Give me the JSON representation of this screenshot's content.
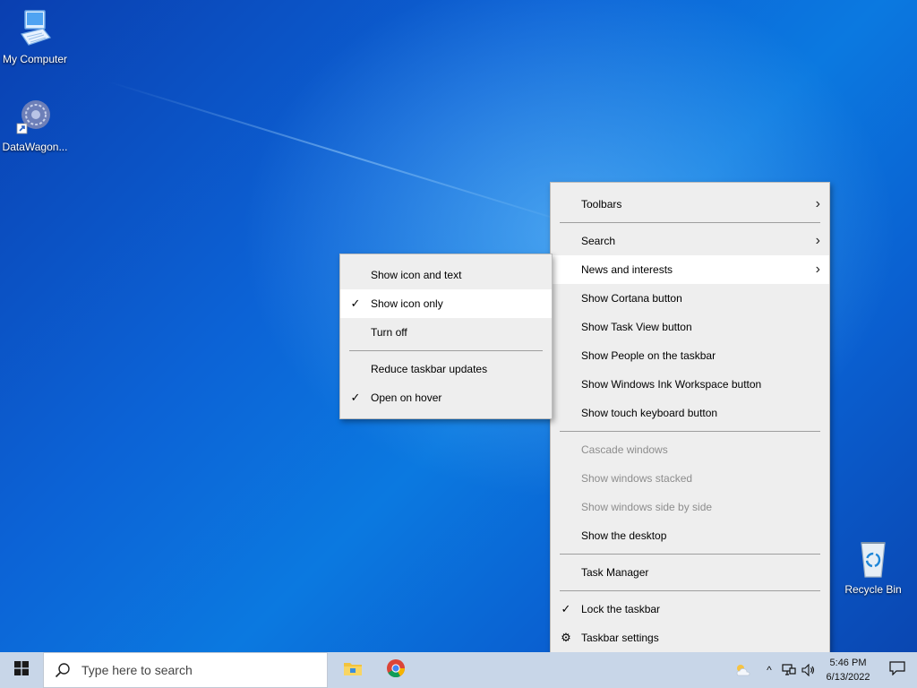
{
  "desktop": {
    "icons": [
      {
        "label": "My Computer",
        "icon": "computer-icon"
      },
      {
        "label": "DataWagon...",
        "icon": "datawagon-app-icon"
      },
      {
        "label": "Recycle Bin",
        "icon": "recycle-bin-icon"
      }
    ]
  },
  "taskbar_menu": {
    "items": [
      {
        "label": "Toolbars",
        "submenu": true
      },
      {
        "label": "Search",
        "submenu": true
      },
      {
        "label": "News and interests",
        "submenu": true,
        "highlighted": true
      },
      {
        "label": "Show Cortana button"
      },
      {
        "label": "Show Task View button"
      },
      {
        "label": "Show People on the taskbar"
      },
      {
        "label": "Show Windows Ink Workspace button"
      },
      {
        "label": "Show touch keyboard button"
      },
      {
        "label": "Cascade windows",
        "disabled": true
      },
      {
        "label": "Show windows stacked",
        "disabled": true
      },
      {
        "label": "Show windows side by side",
        "disabled": true
      },
      {
        "label": "Show the desktop"
      },
      {
        "label": "Task Manager"
      },
      {
        "label": "Lock the taskbar",
        "checked": true
      },
      {
        "label": "Taskbar settings",
        "icon": "gear-icon"
      }
    ]
  },
  "news_submenu": {
    "items": [
      {
        "label": "Show icon and text"
      },
      {
        "label": "Show icon only",
        "checked": true,
        "highlighted": true
      },
      {
        "label": "Turn off"
      },
      {
        "label": "Reduce taskbar updates"
      },
      {
        "label": "Open on hover",
        "checked": true
      }
    ]
  },
  "taskbar": {
    "search_placeholder": "Type here to search",
    "pinned_apps": [
      "file-explorer-icon",
      "chrome-icon"
    ],
    "tray": {
      "weather_icon": "weather-partly-cloudy-icon",
      "chevron": "^",
      "clock_time": "5:46 PM",
      "clock_date": "6/13/2022"
    }
  },
  "colors": {
    "menu_bg": "#eeeeee",
    "menu_highlight": "#ffffff",
    "disabled_text": "#8d8d8d",
    "taskbar_bg": "#c8d6e8"
  }
}
